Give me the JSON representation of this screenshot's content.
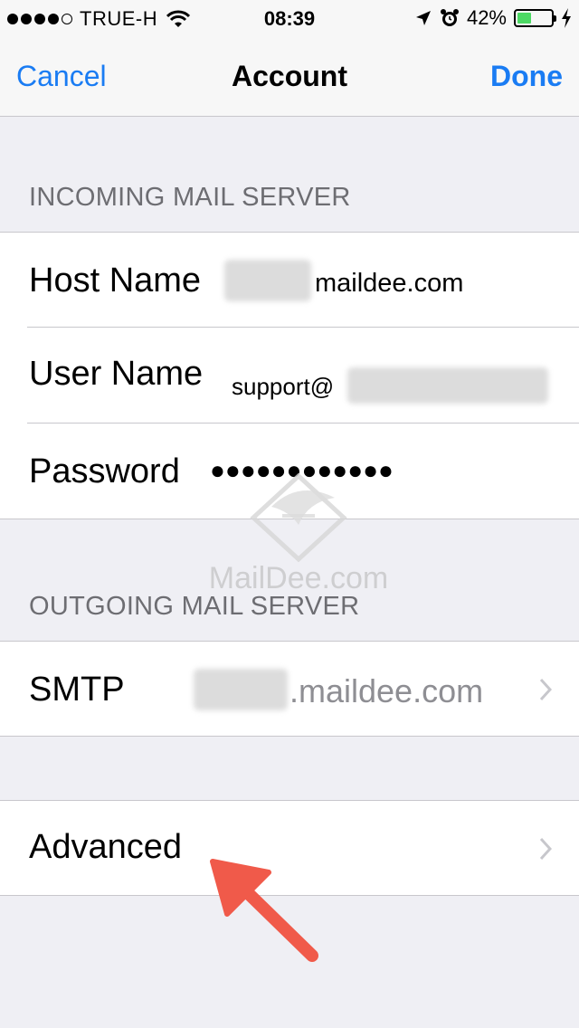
{
  "status_bar": {
    "carrier": "TRUE-H",
    "time": "08:39",
    "battery_percent": "42%",
    "battery_level": 0.42,
    "icons": [
      "signal-dots-icon",
      "wifi-icon",
      "location-arrow-icon",
      "alarm-icon",
      "battery-icon",
      "charging-bolt-icon"
    ]
  },
  "nav": {
    "cancel": "Cancel",
    "title": "Account",
    "done": "Done"
  },
  "incoming": {
    "header": "INCOMING MAIL SERVER",
    "host_label": "Host Name",
    "host_value": "maildee.com",
    "user_label": "User Name",
    "user_value": "support@",
    "password_label": "Password",
    "password_value": "●●●●●●●●●●●●"
  },
  "outgoing": {
    "header": "OUTGOING MAIL SERVER",
    "smtp_label": "SMTP",
    "smtp_value": ".maildee.com"
  },
  "advanced": {
    "label": "Advanced"
  },
  "watermark": {
    "text": "MailDee.com"
  },
  "colors": {
    "accent": "#1a7cf3",
    "background": "#efeff4",
    "arrow": "#f05a4a"
  }
}
